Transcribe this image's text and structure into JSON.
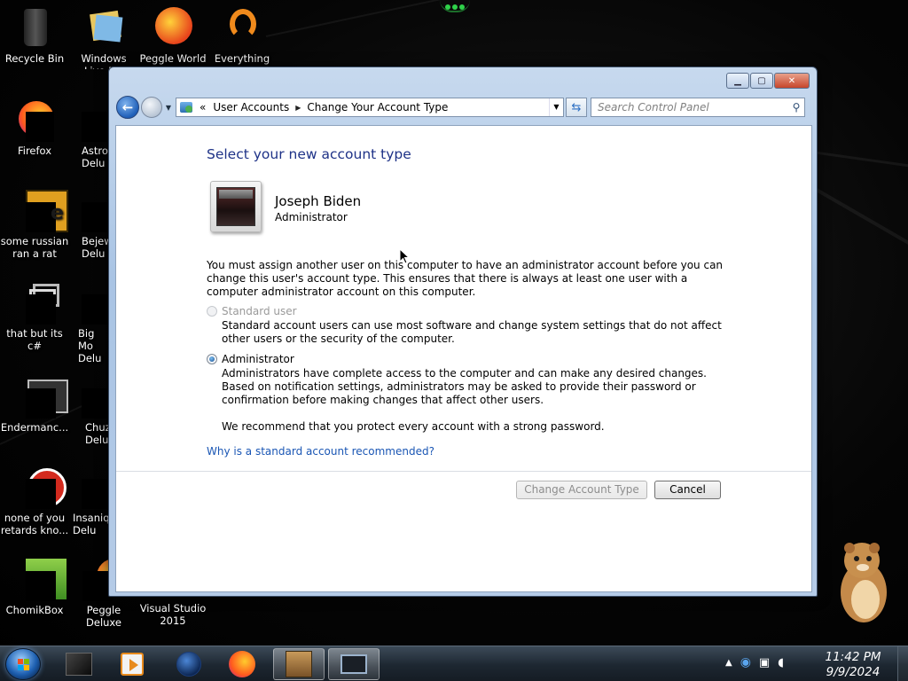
{
  "desktop": {
    "icons": [
      {
        "label": "Recycle Bin"
      },
      {
        "label": "Windows Live Ma"
      },
      {
        "label": "Peggle World"
      },
      {
        "label": "Everything"
      },
      {
        "label": "Firefox"
      },
      {
        "label": "Astro Delu"
      },
      {
        "label": "some russian ran a rat"
      },
      {
        "label": "Bejew Delu"
      },
      {
        "label": "that but its c#"
      },
      {
        "label": "Big Mo Delu"
      },
      {
        "label": "Endermanc..."
      },
      {
        "label": "Chuz Delu"
      },
      {
        "label": "none of you retards kno..."
      },
      {
        "label": "Insaniq Delu"
      },
      {
        "label": "ChomikBox"
      },
      {
        "label": "Peggle Deluxe"
      },
      {
        "label": "Visual Studio 2015"
      }
    ]
  },
  "window": {
    "breadcrumb": {
      "prefix": "«",
      "item1": "User Accounts",
      "item2": "Change Your Account Type"
    },
    "search_placeholder": "Search Control Panel",
    "heading": "Select your new account type",
    "user": {
      "name": "Joseph Biden",
      "role": "Administrator"
    },
    "notice": "You must assign another user on this computer to have an administrator account before you can change this user's account type. This ensures that there is always at least one user with a computer administrator account on this computer.",
    "options": {
      "standard": {
        "label": "Standard user",
        "desc": "Standard account users can use most software and change system settings that do not affect other users or the security of the computer.",
        "checked": false,
        "enabled": false
      },
      "admin": {
        "label": "Administrator",
        "desc": "Administrators have complete access to the computer and can make any desired changes. Based on notification settings, administrators may be asked to provide their password or confirmation before making changes that affect other users.",
        "checked": true,
        "enabled": true
      }
    },
    "recommend": "We recommend that you protect every account with a strong password.",
    "why_link": "Why is a standard account recommended?",
    "change_button": "Change Account Type",
    "cancel_button": "Cancel"
  },
  "taskbar": {
    "time": "11:42 PM",
    "date": "9/9/2024"
  },
  "colors": {
    "heading": "#1e3287",
    "link": "#1a56b4",
    "window_frame": "#b5cbe7"
  }
}
